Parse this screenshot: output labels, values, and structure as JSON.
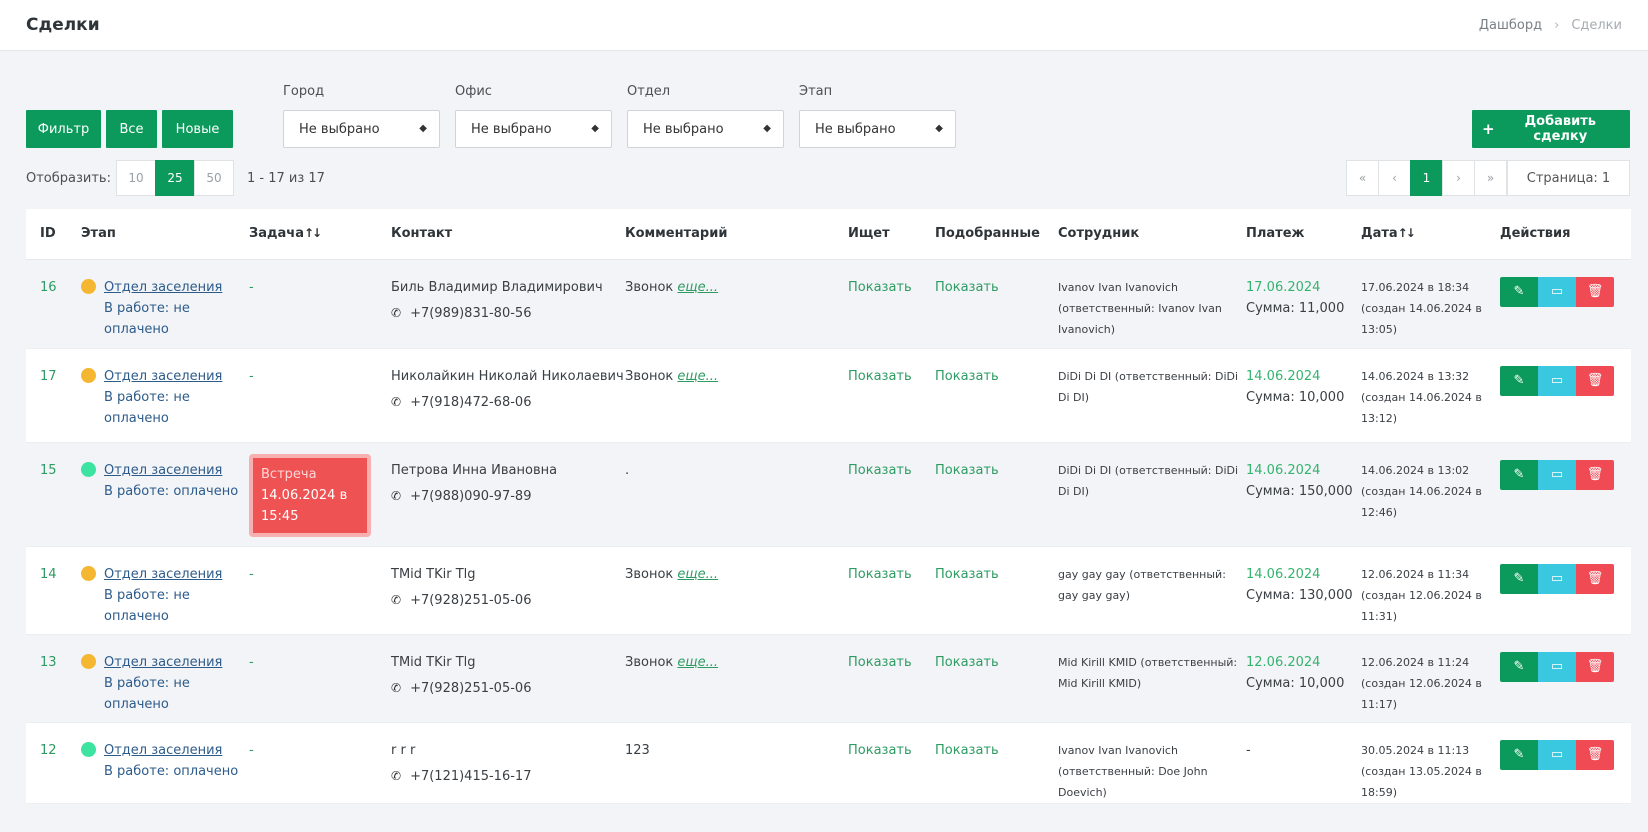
{
  "header": {
    "title": "Сделки",
    "breadcrumb": [
      "Дашборд",
      "Сделки"
    ]
  },
  "filters": {
    "buttons": [
      "Фильтр",
      "Все",
      "Новые"
    ],
    "groups": [
      {
        "label": "Город",
        "value": "Не выбрано"
      },
      {
        "label": "Офис",
        "value": "Не выбрано"
      },
      {
        "label": "Отдел",
        "value": "Не выбрано"
      },
      {
        "label": "Этап",
        "value": "Не выбрано"
      }
    ],
    "add_button": "Добавить сделку",
    "add_icon": "+"
  },
  "pager": {
    "show_label": "Отобразить:",
    "sizes": [
      "10",
      "25",
      "50"
    ],
    "active_size": "25",
    "range": "1 - 17 из 17",
    "first": "«",
    "prev": "‹",
    "current": "1",
    "next": "›",
    "last": "»",
    "page_label": "Страница: 1"
  },
  "table": {
    "headers": {
      "id": "ID",
      "stage": "Этап",
      "task": "Задача",
      "contact": "Контакт",
      "comment": "Комментарий",
      "seeking": "Ищет",
      "matched": "Подобранные",
      "employee": "Сотрудник",
      "payment": "Платеж",
      "date": "Дата",
      "actions": "Действия"
    },
    "sort_icon": "↑↓",
    "phone_icon": "✆",
    "rows": [
      {
        "id": "16",
        "dot": "#f5b731",
        "stage_link": "Отдел заселения",
        "stage_status": "В работе: не оплачено",
        "task": "-",
        "contact": "Биль Владимир Владимирович",
        "phone": "+7(989)831-80-56",
        "comment": "Звонок",
        "more": "еще...",
        "seeking": "Показать",
        "matched": "Показать",
        "employee": "Ivanov Ivan Ivanovich (ответственный: Ivanov Ivan Ivanovich)",
        "pay_date": "17.06.2024",
        "pay_sum": "Сумма: 11,000",
        "date": "17.06.2024 в 18:34 (создан 14.06.2024 в 13:05)"
      },
      {
        "id": "17",
        "dot": "#f5b731",
        "stage_link": "Отдел заселения",
        "stage_status": "В работе: не оплачено",
        "task": "-",
        "contact": "Николайкин Николай Николаевич",
        "phone": "+7(918)472-68-06",
        "comment": "Звонок",
        "more": "еще...",
        "seeking": "Показать",
        "matched": "Показать",
        "employee": "DiDi Di DI (ответственный: DiDi Di DI)",
        "pay_date": "14.06.2024",
        "pay_sum": "Сумма: 10,000",
        "date": "14.06.2024 в 13:32 (создан 14.06.2024 в 13:12)"
      },
      {
        "id": "15",
        "dot": "#3de3a0",
        "stage_link": "Отдел заселения",
        "stage_status": "В работе: оплачено",
        "task_title": "Встреча",
        "task_date": "14.06.2024 в 15:45",
        "contact": "Петрова Инна Ивановна",
        "phone": "+7(988)090-97-89",
        "comment": ".",
        "more": "",
        "seeking": "Показать",
        "matched": "Показать",
        "employee": "DiDi Di DI (ответственный: DiDi Di DI)",
        "pay_date": "14.06.2024",
        "pay_sum": "Сумма: 150,000",
        "date": "14.06.2024 в 13:02 (создан 14.06.2024 в 12:46)"
      },
      {
        "id": "14",
        "dot": "#f5b731",
        "stage_link": "Отдел заселения",
        "stage_status": "В работе: не оплачено",
        "task": "-",
        "contact": "TMid TKir Tlg",
        "phone": "+7(928)251-05-06",
        "comment": "Звонок",
        "more": "еще...",
        "seeking": "Показать",
        "matched": "Показать",
        "employee": "gay gay gay (ответственный: gay gay gay)",
        "pay_date": "14.06.2024",
        "pay_sum": "Сумма: 130,000",
        "date": "12.06.2024 в 11:34 (создан 12.06.2024 в 11:31)"
      },
      {
        "id": "13",
        "dot": "#f5b731",
        "stage_link": "Отдел заселения",
        "stage_status": "В работе: не оплачено",
        "task": "-",
        "contact": "TMid TKir Tlg",
        "phone": "+7(928)251-05-06",
        "comment": "Звонок",
        "more": "еще...",
        "seeking": "Показать",
        "matched": "Показать",
        "employee": "Mid Kirill KMID (ответственный: Mid Kirill KMID)",
        "pay_date": "12.06.2024",
        "pay_sum": "Сумма: 10,000",
        "date": "12.06.2024 в 11:24 (создан 12.06.2024 в 11:17)"
      },
      {
        "id": "12",
        "dot": "#3de3a0",
        "stage_link": "Отдел заселения",
        "stage_status": "В работе: оплачено",
        "task": "-",
        "contact": "r r r",
        "phone": "+7(121)415-16-17",
        "comment": "123",
        "more": "",
        "seeking": "Показать",
        "matched": "Показать",
        "employee": "Ivanov Ivan Ivanovich (ответственный: Doe John Doevich)",
        "pay_date": "",
        "pay_sum": "-",
        "date": "30.05.2024 в 11:13 (создан 13.05.2024 в 18:59)"
      }
    ]
  }
}
